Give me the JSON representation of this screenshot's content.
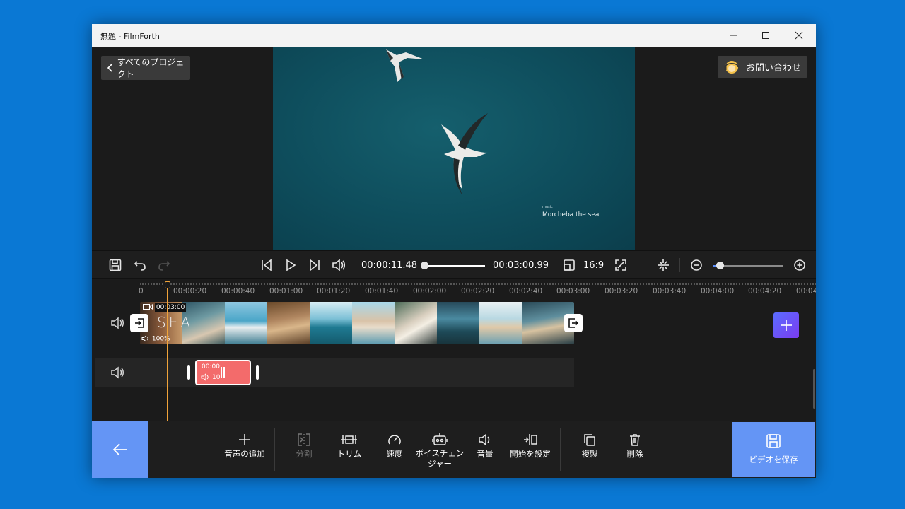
{
  "window": {
    "title": "無題 - FilmForth"
  },
  "preview": {
    "back_projects_label": "すべてのプロジェクト",
    "contact_label": "お問い合わせ",
    "music_caption": "music",
    "music_title": "Morcheba  the sea"
  },
  "controls": {
    "current_time": "00:00:11.48",
    "total_time": "00:03:00.99",
    "aspect_ratio": "16:9",
    "playback_progress": 0.06,
    "zoom_level": 0.1
  },
  "timeline": {
    "ruler_ticks": [
      "0",
      "00:00:20",
      "00:00:40",
      "00:01:00",
      "00:01:20",
      "00:01:40",
      "00:02:00",
      "00:02:20",
      "00:02:40",
      "00:03:00",
      "00:03:20",
      "00:03:40",
      "00:04:00",
      "00:04:20",
      "00:04"
    ],
    "video_clip_duration": "00:03:00",
    "video_clip_volume": "100%",
    "video_title_text": "SEA",
    "audio_clip_time": "00:00:",
    "audio_clip_volume": "10"
  },
  "toolbar": {
    "add_audio": "音声の追加",
    "split": "分割",
    "trim": "トリム",
    "speed": "速度",
    "voice_changer": "ボイスチェン\nジャー",
    "volume": "音量",
    "set_start": "開始を設定",
    "duplicate": "複製",
    "delete": "削除",
    "save_video": "ビデオを保存"
  },
  "colors": {
    "accent": "#6495f5",
    "playhead": "#f0a33a",
    "audio_clip": "#f36b6b",
    "desktop": "#0a78d4"
  }
}
